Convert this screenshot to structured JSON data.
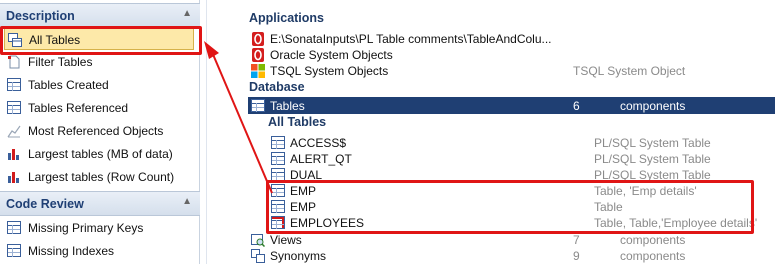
{
  "left_panel": {
    "description_header": "Description",
    "description_items": [
      {
        "label": "All Tables",
        "icon": "all-tables-icon",
        "selected": true
      },
      {
        "label": "Filter Tables",
        "icon": "filter-page-icon"
      },
      {
        "label": "Tables Created",
        "icon": "table-icon"
      },
      {
        "label": "Tables Referenced",
        "icon": "table-icon"
      },
      {
        "label": "Most Referenced Objects",
        "icon": "bar-chart-icon"
      },
      {
        "label": "Largest tables (MB of data)",
        "icon": "bar-chart-icon"
      },
      {
        "label": "Largest tables (Row Count)",
        "icon": "bar-chart-icon"
      }
    ],
    "code_review_header": "Code Review",
    "code_review_items": [
      {
        "label": "Missing Primary Keys",
        "icon": "table-icon"
      },
      {
        "label": "Missing Indexes",
        "icon": "table-icon"
      }
    ]
  },
  "right_panel": {
    "applications_header": "Applications",
    "applications": [
      {
        "name": "E:\\SonataInputs\\PL Table comments\\TableAndColu...",
        "type": "",
        "icon": "oracle-icon"
      },
      {
        "name": "Oracle System Objects",
        "type": "",
        "icon": "oracle-icon"
      },
      {
        "name": "TSQL System Objects",
        "type": "TSQL System Object",
        "icon": "windows-icon"
      }
    ],
    "database_header": "Database",
    "tables_row": {
      "name": "Tables",
      "count": "6",
      "unit": "components"
    },
    "all_tables_header": "All Tables",
    "tables": [
      {
        "name": "ACCESS$",
        "type": "PL/SQL System Table"
      },
      {
        "name": "ALERT_QT",
        "type": "PL/SQL System Table"
      },
      {
        "name": "DUAL",
        "type": "PL/SQL System Table"
      },
      {
        "name": "EMP",
        "type": "Table, 'Emp details'"
      },
      {
        "name": "EMP",
        "type": "Table"
      },
      {
        "name": "EMPLOYEES",
        "type": "Table, Table,'Employee details'"
      }
    ],
    "views_row": {
      "name": "Views",
      "count": "7",
      "unit": "components"
    },
    "synonyms_row": {
      "name": "Synonyms",
      "count": "9",
      "unit": "components"
    }
  },
  "colors": {
    "selection_bg": "#1f3f73",
    "annotation_red": "#e01515",
    "header_text": "#1f3b66",
    "selected_nav_bg": "#fde9a9"
  }
}
